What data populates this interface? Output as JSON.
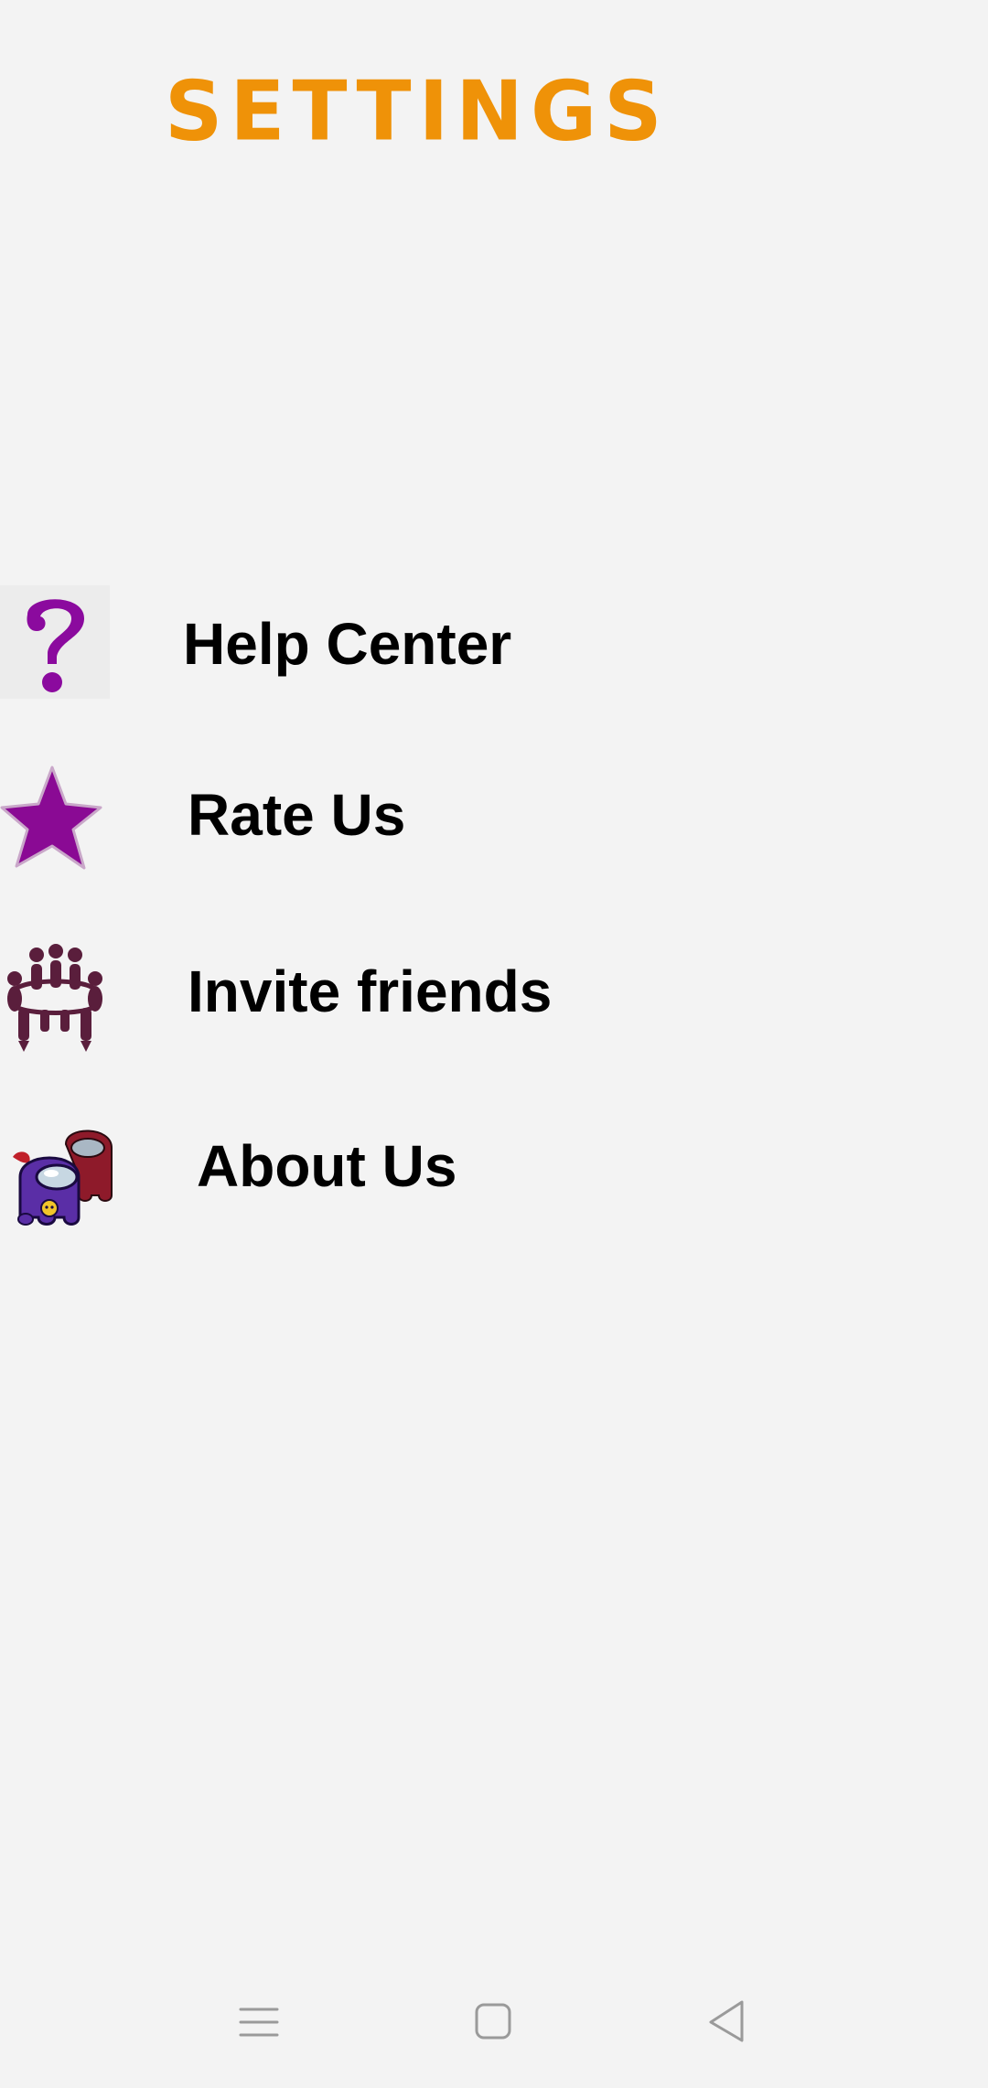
{
  "header": {
    "title": "SETTINGS",
    "title_color": "#ef9208"
  },
  "menu": {
    "items": [
      {
        "label": "Help Center",
        "icon": "question-mark-icon",
        "icon_color": "#8b0a9e"
      },
      {
        "label": "Rate Us",
        "icon": "star-icon",
        "icon_color": "#8a0a94"
      },
      {
        "label": "Invite friends",
        "icon": "people-circle-icon",
        "icon_color": "#5a1e3c"
      },
      {
        "label": "About Us",
        "icon": "crewmates-icon",
        "icon_color": "#5a2ea6"
      }
    ]
  },
  "navbar": {
    "buttons": [
      {
        "icon": "recent-apps-icon"
      },
      {
        "icon": "home-icon"
      },
      {
        "icon": "back-icon"
      }
    ]
  }
}
